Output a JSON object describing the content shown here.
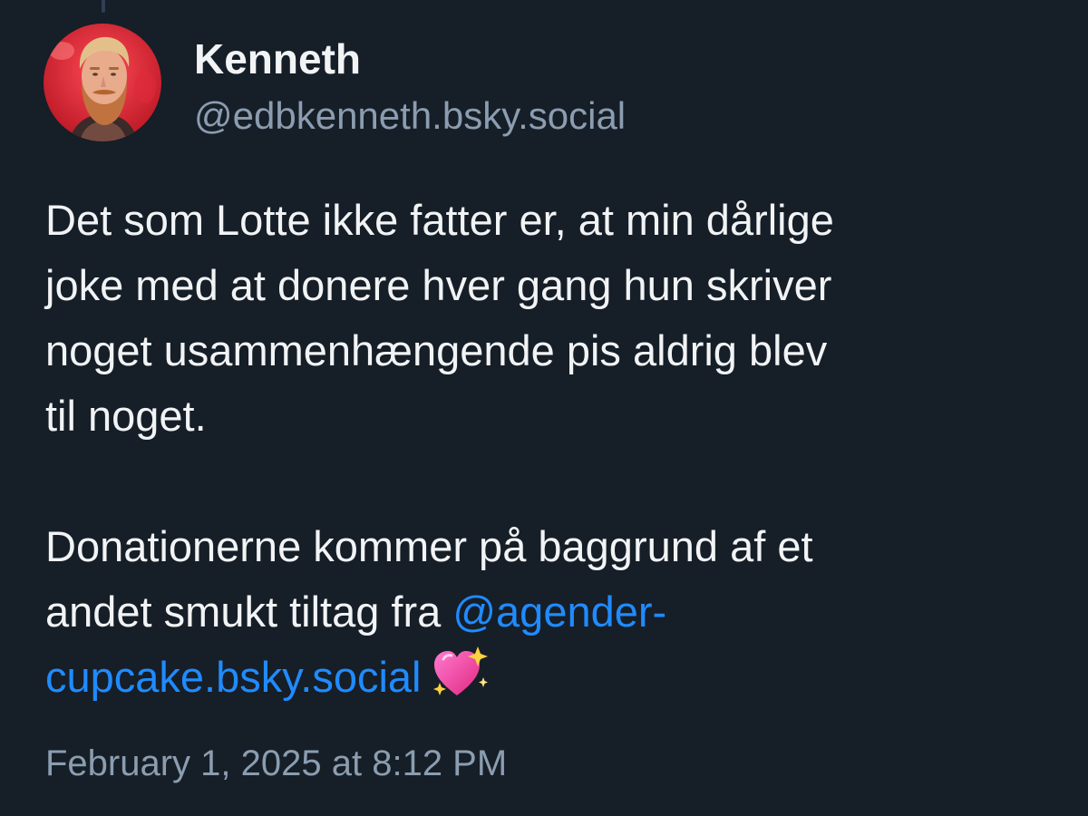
{
  "post": {
    "author": {
      "display_name": "Kenneth",
      "handle": "@edbkenneth.bsky.social",
      "avatar_icon": "person-avatar"
    },
    "text": {
      "paragraph1_lines": [
        "Det som Lotte ikke fatter er, at min dårlige",
        "joke med at donere hver gang hun skriver",
        "noget usammenhængende pis aldrig blev",
        "til noget."
      ],
      "paragraph2_line1": "Donationerne kommer på baggrund af et",
      "paragraph2_line2_text": "andet smukt tiltag fra ",
      "mention_part1": "@agender-",
      "mention_part2": "cupcake.bsky.social",
      "emoji_icon": "sparkling-heart-icon"
    },
    "timestamp": "February 1, 2025 at 8:12 PM"
  },
  "colors": {
    "background": "#161e27",
    "text": "#f1f3f5",
    "secondary_text": "#8b9db0",
    "link": "#208bfe",
    "thread_line": "#2e4052"
  }
}
